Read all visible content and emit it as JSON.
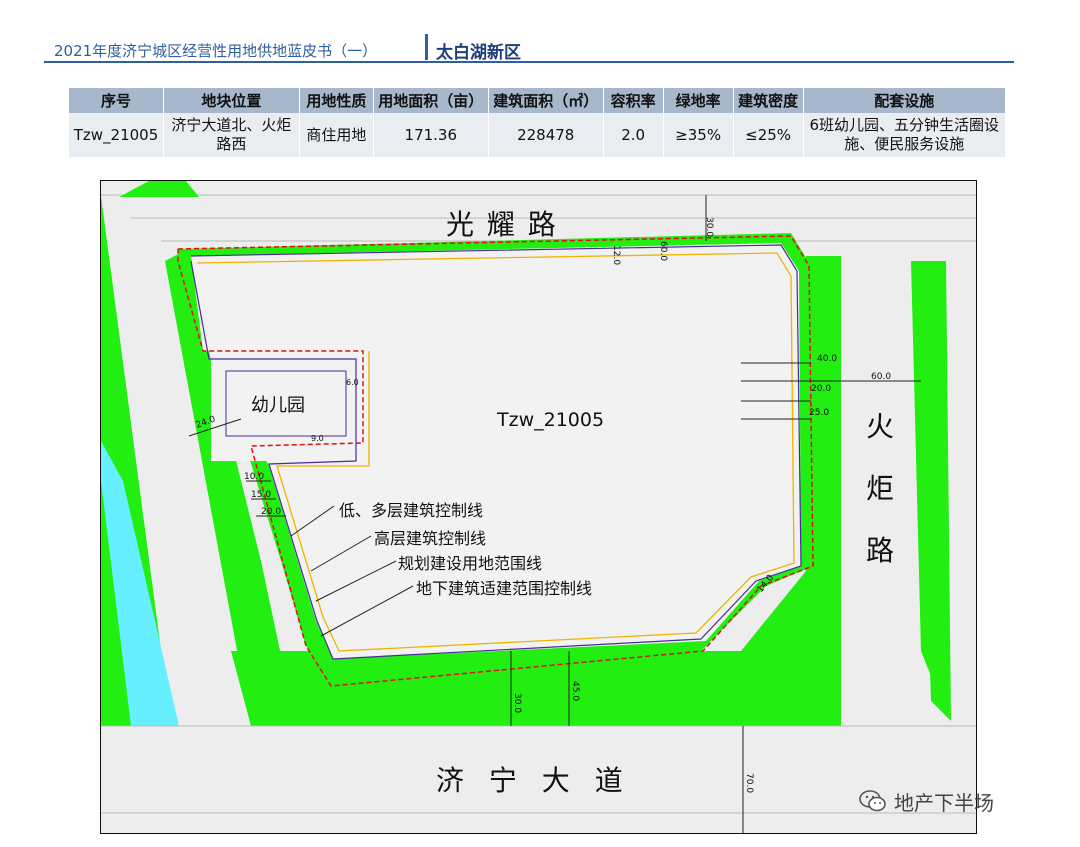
{
  "header": {
    "subtitle": "2021年度济宁城区经营性用地供地蓝皮书（一）",
    "district": "太白湖新区"
  },
  "table": {
    "columns": [
      "序号",
      "地块位置",
      "用地性质",
      "用地面积（亩）",
      "建筑面积（㎡）",
      "容积率",
      "绿地率",
      "建筑密度",
      "配套设施"
    ],
    "rows": [
      [
        "Tzw_21005",
        "济宁大道北、火炬路西",
        "商住用地",
        "171.36",
        "228478",
        "2.0",
        "≥35%",
        "≤25%",
        "6班幼儿园、五分钟生活圈设施、便民服务设施"
      ]
    ]
  },
  "map": {
    "roads": {
      "north": "光 耀 路",
      "east": [
        "火",
        "炬",
        "路"
      ],
      "south": "济 宁 大 道"
    },
    "parcel_label": "Tzw_21005",
    "kindergarten_label": "幼儿园",
    "legend": [
      "低、多层建筑控制线",
      "高层建筑控制线",
      "规划建设用地范围线",
      "地下建筑适建范围控制线"
    ],
    "dimensions": [
      "30.0",
      "12.0",
      "60.0",
      "40.0",
      "20.0",
      "25.0",
      "60.0",
      "24.0",
      "10.0",
      "15.0",
      "20.0",
      "30.0",
      "45.0",
      "70.0",
      "14.0",
      "6.0",
      "9.0"
    ],
    "colors": {
      "green": "#22ee11",
      "water": "#66f0ff",
      "road": "#ededed",
      "red_line": "#dd1111",
      "orange_line": "#f0b400",
      "purple_line": "#4b2a9a",
      "header_blue": "#2f5f9e"
    }
  },
  "watermark": {
    "icon": "wechat-icon",
    "text": "地产下半场"
  }
}
